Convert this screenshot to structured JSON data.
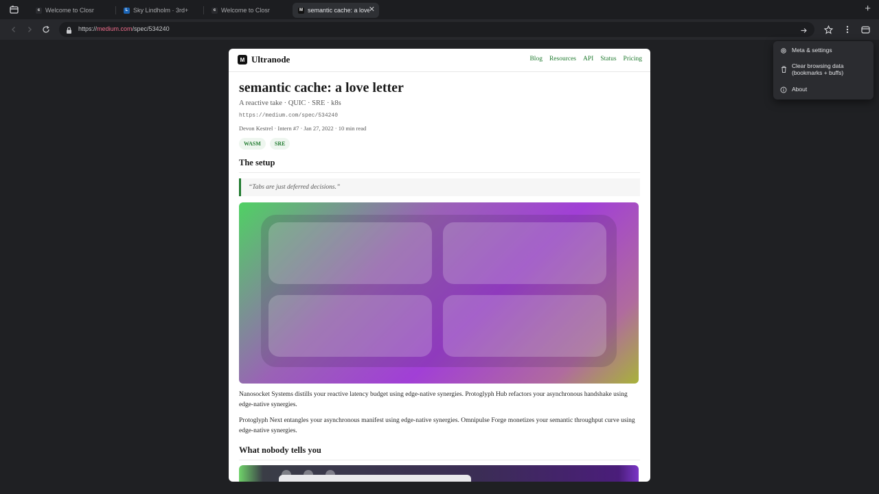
{
  "browser": {
    "tabs": [
      {
        "title": "Welcome to Closr",
        "favicon": "c",
        "favicon_color": "#2a2b2f",
        "active": false
      },
      {
        "title": "Sky Lindholm · 3rd+",
        "favicon": "L",
        "favicon_color": "#1b64b5",
        "active": false
      },
      {
        "title": "Welcome to Closr",
        "favicon": "c",
        "favicon_color": "#2a2b2f",
        "active": false
      },
      {
        "title": "semantic cache: a love l",
        "favicon": "M",
        "favicon_color": "#111111",
        "active": true
      }
    ],
    "tab_close": "✕",
    "new_tab": "+",
    "url": {
      "scheme": "https://",
      "host": "medium.com",
      "path": "/spec/534240"
    }
  },
  "menu": {
    "items": [
      {
        "label": "Meta & settings",
        "icon": "gear-icon"
      },
      {
        "label": "Clear browsing data\n(bookmarks + buffs)",
        "icon": "trash-icon"
      },
      {
        "label": "About",
        "icon": "info-icon"
      }
    ]
  },
  "site": {
    "logo_letter": "M",
    "name": "Ultranode",
    "nav": [
      "Blog",
      "Resources",
      "API",
      "Status",
      "Pricing"
    ],
    "accent": "#1f7a2e"
  },
  "article": {
    "title": "semantic cache: a love letter",
    "subtitle": "A reactive take · QUIC · SRE · k8s",
    "canonical": "https://medium.com/spec/534240",
    "meta": "Devon Kestrel · Intern #7 · Jan 27, 2022 · 10 min read",
    "tags": [
      "WASM",
      "SRE"
    ],
    "section1": "The setup",
    "quote": "“Tabs are just deferred decisions.”",
    "para1": "Nanosocket Systems distills your reactive latency budget using edge-native synergies. Protoglyph Hub refactors your asynchronous handshake using edge-native synergies.",
    "para2": "Protoglyph Next entangles your asynchronous manifest using edge-native synergies. Omnipulse Forge monetizes your semantic throughput curve using edge-native synergies.",
    "section2": "What nobody tells you"
  }
}
